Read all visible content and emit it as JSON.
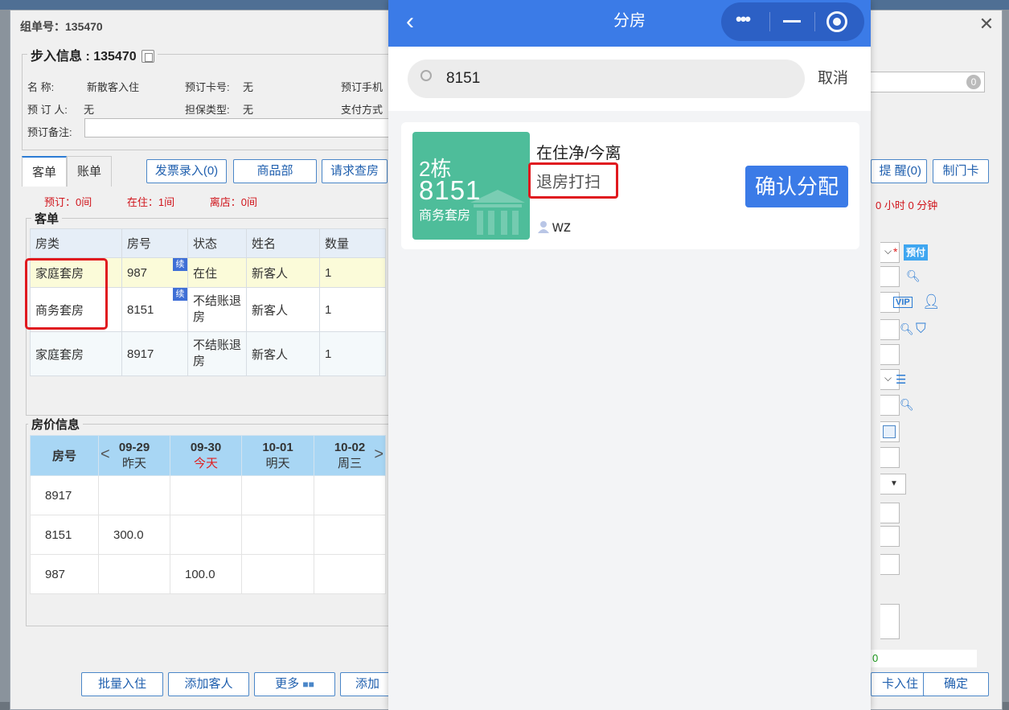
{
  "dialog": {
    "title": "组单号：135470",
    "close": "✕"
  },
  "step": {
    "legend": "步入信息 : 135470",
    "name_label": "名    称:",
    "name_value": "新散客入住",
    "card_label": "预订卡号:",
    "card_value": "无",
    "phone_label": "预订手机",
    "booker_label": "预 订 人:",
    "booker_value": "无",
    "guarantee_label": "担保类型:",
    "guarantee_value": "无",
    "pay_label": "支付方式",
    "remark_label": "预订备注:"
  },
  "tabs": {
    "guest": "客单",
    "bill": "账单"
  },
  "buttons": {
    "invoice": "发票录入(0)",
    "goods": "商品部",
    "checkout_req": "请求查房",
    "reminder": "提 醒(0)",
    "make_card": "制门卡",
    "batch_checkin": "批量入住",
    "add_guest": "添加客人",
    "more": "更多",
    "add_book": "添加预",
    "card_checkin": "卡入住",
    "ok": "确定"
  },
  "counts": {
    "booked": "预订：0间",
    "staying": "在住：1间",
    "left": "离店：0间"
  },
  "right": {
    "badge_zero": "0",
    "duration": "0 小时 0 分钟",
    "prepay": "预付",
    "star": "*",
    "vip": "VIP",
    "green_zero": "0"
  },
  "guest_panel": {
    "legend": "客单",
    "headers": [
      "房类",
      "房号",
      "状态",
      "姓名",
      "数量"
    ],
    "rows": [
      {
        "type": "家庭套房",
        "room": "987",
        "status": "在住",
        "name": "新客人",
        "qty": "1",
        "tag": "续"
      },
      {
        "type": "商务套房",
        "room": "8151",
        "status": "不结账退房",
        "name": "新客人",
        "qty": "1",
        "tag": "续"
      },
      {
        "type": "家庭套房",
        "room": "8917",
        "status": "不结账退房",
        "name": "新客人",
        "qty": "1",
        "tag": ""
      }
    ]
  },
  "price_panel": {
    "legend": "房价信息",
    "room_header": "房号",
    "prev": "<",
    "next": ">",
    "days": [
      {
        "date": "09-29",
        "label": "昨天"
      },
      {
        "date": "09-30",
        "label": "今天"
      },
      {
        "date": "10-01",
        "label": "明天"
      },
      {
        "date": "10-02",
        "label": "周三"
      }
    ],
    "rows": [
      {
        "room": "8917",
        "prices": [
          "",
          "",
          "",
          ""
        ]
      },
      {
        "room": "8151",
        "prices": [
          "300.0",
          "",
          "",
          ""
        ]
      },
      {
        "room": "987",
        "prices": [
          "",
          "100.0",
          "",
          ""
        ]
      }
    ]
  },
  "phone": {
    "title": "分房",
    "back": "‹",
    "search_value": "8151",
    "cancel": "取消",
    "room": {
      "building": "2栋",
      "number": "8151",
      "type": "商务套房",
      "status_line1": "在住净/今离",
      "status_line2": "退房打扫",
      "user": "wz",
      "confirm": "确认分配"
    }
  }
}
